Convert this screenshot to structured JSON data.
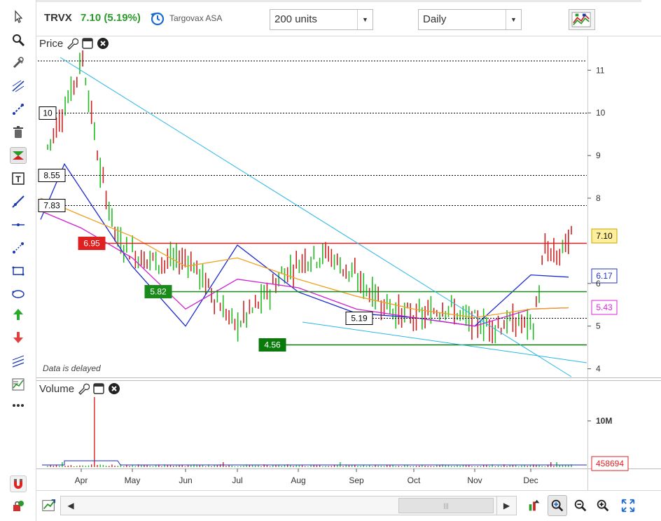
{
  "header": {
    "symbol": "TRVX",
    "last_change": "7.10 (5.19%)",
    "company": "Targovax ASA",
    "range_select": "200 units",
    "interval_select": "Daily"
  },
  "price_pane": {
    "label": "Price",
    "delayed_note": "Data is delayed",
    "y_ticks": [
      "11",
      "10",
      "9",
      "8",
      "6",
      "5",
      "4"
    ],
    "h_levels": [
      {
        "label": "10",
        "value": 10.0,
        "style": "dotted",
        "color": "#000000"
      },
      {
        "label": "8.55",
        "value": 8.55,
        "style": "dotted",
        "color": "#000000"
      },
      {
        "label": "7.83",
        "value": 7.83,
        "style": "dotted",
        "color": "#000000"
      },
      {
        "label": "6.95",
        "value": 6.95,
        "style": "solid",
        "color": "#e02020"
      },
      {
        "label": "5.82",
        "value": 5.82,
        "style": "solid",
        "color": "#1a8a1a"
      },
      {
        "label": "5.19",
        "value": 5.19,
        "style": "dotted",
        "color": "#000000"
      },
      {
        "label": "4.56",
        "value": 4.56,
        "style": "solid",
        "color": "#0a7a0a"
      }
    ],
    "right_badges": [
      {
        "label": "7.10",
        "value": 7.1,
        "bg": "#ffef9a",
        "fg": "#000000",
        "border": "#c8a400"
      },
      {
        "label": "6.17",
        "value": 6.17,
        "bg": "#ffffff",
        "fg": "#2233bb",
        "border": "#2233bb"
      },
      {
        "label": "5.43",
        "value": 5.43,
        "bg": "#ffffff",
        "fg": "#dd22dd",
        "border": "#dd22dd"
      }
    ]
  },
  "volume_pane": {
    "label": "Volume",
    "y_ticks": [
      "10M"
    ],
    "last_volume": "458694"
  },
  "x_axis": {
    "months": [
      "Apr",
      "May",
      "Jun",
      "Jul",
      "Aug",
      "Sep",
      "Oct",
      "Nov",
      "Dec"
    ]
  },
  "colors": {
    "up": "#22bb22",
    "down": "#cc2222",
    "ma_fast": "#1a2ad0",
    "ma_mid": "#d020d0",
    "ma_slow": "#f0a020",
    "trendline": "#29b6e6"
  },
  "chart_data": {
    "type": "line",
    "title": "",
    "xlabel": "",
    "ylabel": "",
    "ylim": [
      3.8,
      11.7
    ],
    "x": [
      "Apr",
      "May",
      "Jun",
      "Jul",
      "Aug",
      "Sep",
      "Oct",
      "Nov",
      "Dec"
    ],
    "series": [
      {
        "values": [
          8.8,
          6.4,
          5.0,
          6.9,
          5.8,
          5.3,
          5.2,
          5.0,
          6.2
        ]
      },
      {
        "values": [
          7.3,
          6.6,
          5.4,
          6.1,
          5.9,
          5.4,
          5.2,
          5.0,
          5.4
        ]
      },
      {
        "values": [
          7.6,
          7.1,
          6.4,
          6.6,
          6.1,
          5.7,
          5.4,
          5.2,
          5.4
        ]
      }
    ]
  }
}
